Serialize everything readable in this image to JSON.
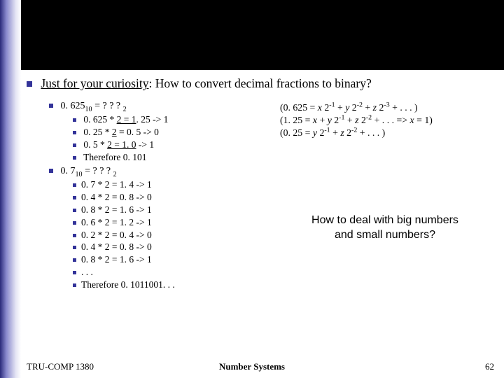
{
  "question": {
    "prefix": "Just for your curiosity",
    "rest": ": How to convert decimal fractions to binary?"
  },
  "example1": {
    "head_a": "0. 625",
    "head_sub": "10",
    "head_b": " = ? ? ? ",
    "head_sub2": "2",
    "steps": [
      {
        "pre": "0. 625 * ",
        "u": "2 = 1",
        "post": ". 25 -> 1"
      },
      {
        "pre": "0. 25 * ",
        "u": "2",
        "post": " = 0. 5 -> 0"
      },
      {
        "pre": "0. 5 * ",
        "u": "2 = 1. 0",
        "post": " -> 1"
      },
      {
        "pre": "Therefore 0. 101",
        "u": "",
        "post": ""
      }
    ]
  },
  "example2": {
    "head_a": "0. 7",
    "head_sub": "10",
    "head_b": " = ? ? ? ",
    "head_sub2": "2",
    "steps": [
      "0. 7 * 2 = 1. 4 -> 1",
      "0. 4 * 2 = 0. 8 -> 0",
      "0. 8 * 2 = 1. 6 -> 1",
      "0. 6 * 2 = 1. 2 -> 1",
      "0. 2 * 2 = 0. 4 -> 0",
      "0. 4 * 2 = 0. 8 -> 0",
      "0. 8 * 2 = 1. 6 -> 1",
      ". . .",
      "Therefore 0. 1011001. . ."
    ]
  },
  "rightNotes": {
    "l1": {
      "a": "(0. 625 = ",
      "x": "x",
      "b": " 2",
      "e1": "-1",
      "c": " + ",
      "y": "y",
      "d": " 2",
      "e2": "-2",
      "e": " + ",
      "z": "z",
      "f": " 2",
      "e3": "-3",
      "g": " + . . . )"
    },
    "l2": {
      "a": "(1. 25 = ",
      "x": "x",
      "b": " + ",
      "y": "y",
      "c": " 2",
      "e1": "-1",
      "d": " + ",
      "z": "z",
      "e": " 2",
      "e2": "-2",
      "f": " + . . .  => ",
      "x2": "x",
      "g": " = 1)"
    },
    "l3": {
      "a": "(0. 25 = ",
      "y": "y",
      "b": " 2",
      "e1": "-1",
      "c": " + ",
      "z": "z",
      "d": " 2",
      "e2": "-2",
      "e": " + . . . )"
    }
  },
  "bigQuestion": {
    "line1": "How to deal with big numbers",
    "line2": "and small numbers?"
  },
  "footer": {
    "left": "TRU-COMP 1380",
    "center": "Number Systems",
    "right": "62"
  }
}
